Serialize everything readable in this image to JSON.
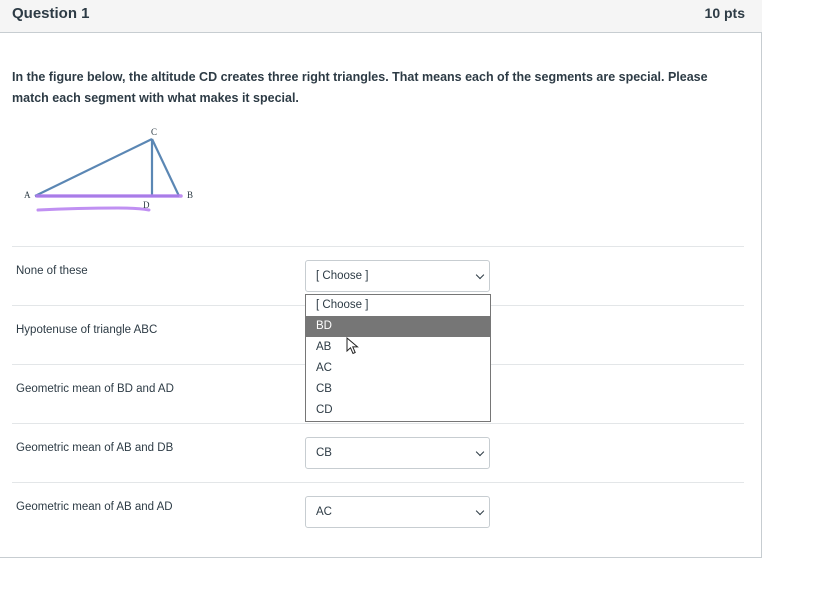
{
  "question": {
    "title": "Question 1",
    "points": "10 pts",
    "text": "In the figure below, the altitude CD creates three right triangles. That means each of the segments are special. Please match each segment with what makes it special."
  },
  "figure": {
    "label_a": "A",
    "label_b": "B",
    "label_c": "C",
    "label_d": "D",
    "annotation_color": "#b57cf0"
  },
  "matches": [
    {
      "label": "None of these",
      "value": "[ Choose ]"
    },
    {
      "label": "Hypotenuse of triangle ABC",
      "value": ""
    },
    {
      "label": "Geometric mean of BD and AD",
      "value": ""
    },
    {
      "label": "Geometric mean of AB and DB",
      "value": "CB"
    },
    {
      "label": "Geometric mean of AB and AD",
      "value": "AC"
    }
  ],
  "dropdown": {
    "highlighted": "BD",
    "options": [
      "[ Choose ]",
      "BD",
      "AB",
      "AC",
      "CB",
      "CD"
    ]
  },
  "colors": {
    "header_bg": "#f5f5f5",
    "text": "#2d3b45",
    "highlight": "#767676",
    "triangle": "#5b87b4"
  }
}
